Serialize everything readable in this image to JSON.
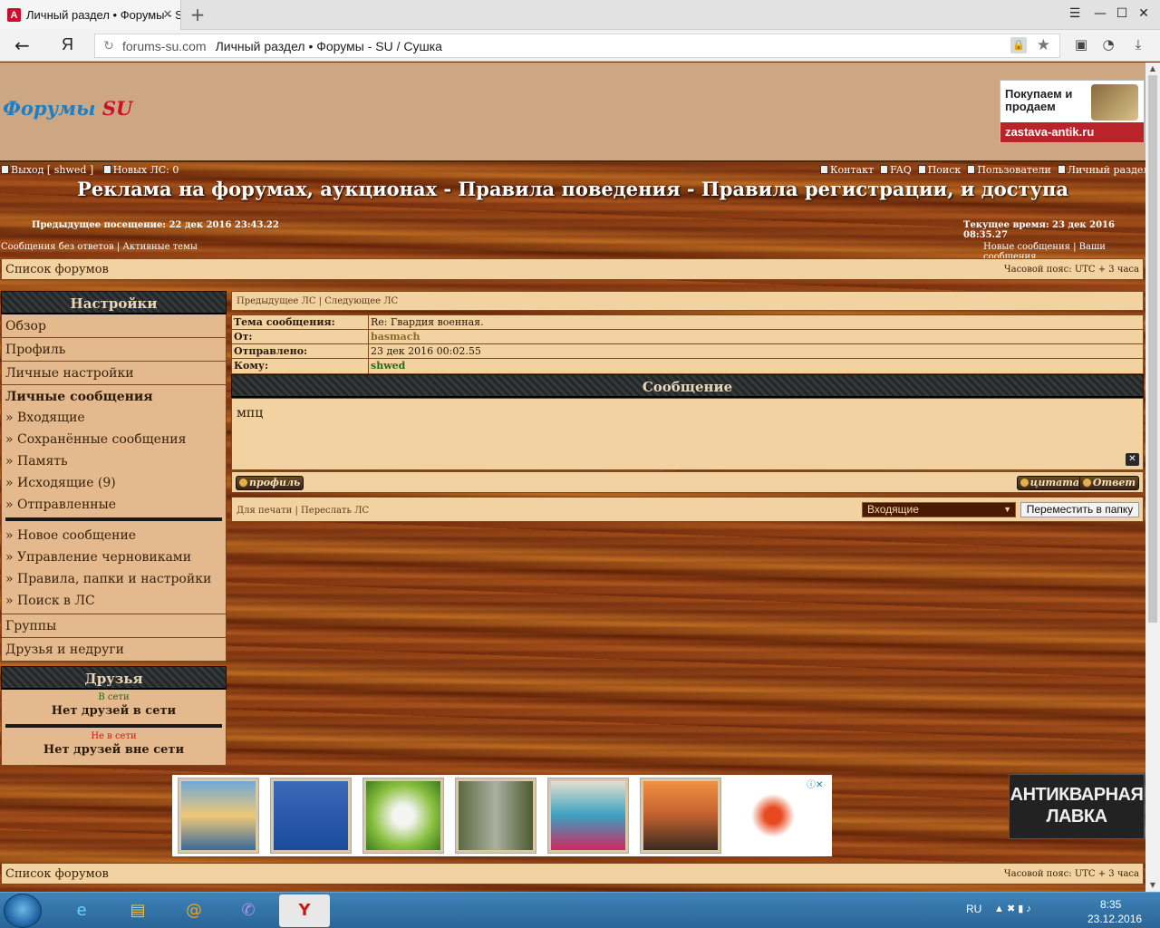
{
  "browser": {
    "tab_title": "Личный раздел • Форумы - SU / Сушка",
    "url_domain": "forums-su.com",
    "url_title": "Личный раздел • Форумы - SU / Сушка",
    "yandex_label": "Я"
  },
  "header": {
    "logo_text": "Форумы",
    "logo_accent": "SU",
    "ad_text": "Покупаем и продаем",
    "ad_url": "zastava-antik.ru"
  },
  "toplinks": {
    "logout": "Выход [ shwed ]",
    "new_pm": "Новых ЛС: 0",
    "contact": "Контакт",
    "faq": "FAQ",
    "search": "Поиск",
    "users": "Пользователи",
    "personal": "Личный раздел"
  },
  "site_title": "Реклама на форумах, аукционах - Правила поведения - Правила регистрации, и доступа",
  "stamps": {
    "last_visit": "Предыдущее посещение: 22 дек 2016 23:43.22",
    "current_time": "Текущее время: 23 дек 2016 08:35.27"
  },
  "sublinks": {
    "left": "Сообщения без ответов | Активные темы",
    "right": "Новые сообщения | Ваши сообщения"
  },
  "forum_bar": {
    "label": "Список форумов",
    "timezone": "Часовой пояс: UTC + 3 часа"
  },
  "sidebar": {
    "settings_title": "Настройки",
    "items": [
      "Обзор",
      "Профиль",
      "Личные настройки"
    ],
    "pm_title": "Личные сообщения",
    "pm_items": [
      "» Входящие",
      "» Сохранённые сообщения",
      "» Память",
      "» Исходящие (9)",
      "» Отправленные"
    ],
    "pm_items2": [
      "» Новое сообщение",
      "» Управление черновиками",
      "» Правила, папки и настройки",
      "» Поиск в ЛС"
    ],
    "groups": "Группы",
    "friends_foes": "Друзья и недруги",
    "friends_title": "Друзья",
    "online_label": "В сети",
    "online_none": "Нет друзей в сети",
    "offline_label": "Не в сети",
    "offline_none": "Нет друзей вне сети"
  },
  "message": {
    "nav": "Предыдущее ЛС | Следующее ЛС",
    "fields": [
      {
        "key": "Тема сообщения:",
        "value": "Re: Гвардия военная."
      },
      {
        "key": "От:",
        "value": "basmach"
      },
      {
        "key": "Отправлено:",
        "value": "23 дек 2016 00:02.55"
      },
      {
        "key": "Кому:",
        "value": "shwed"
      }
    ],
    "section_title": "Сообщение",
    "body": "мпц",
    "profile_btn": "профиль",
    "quote_btn": "цитата",
    "reply_btn": "Ответ",
    "actions": "Для печати | Переслать ЛС",
    "folder_selected": "Входящие",
    "move_btn": "Переместить в папку"
  },
  "ad_right": "АНТИКВАРНАЯ ЛАВКА",
  "footer_bar": {
    "label": "Список форумов",
    "timezone": "Часовой пояс: UTC + 3 часа"
  },
  "taskbar": {
    "lang": "RU",
    "time": "8:35",
    "date": "23.12.2016"
  },
  "colors": {
    "panel": "#f1d2a0",
    "nav": "#e4b98e",
    "header_bg": "#cda781",
    "logo_blue": "#1c7ec4",
    "logo_red": "#c8102e"
  }
}
